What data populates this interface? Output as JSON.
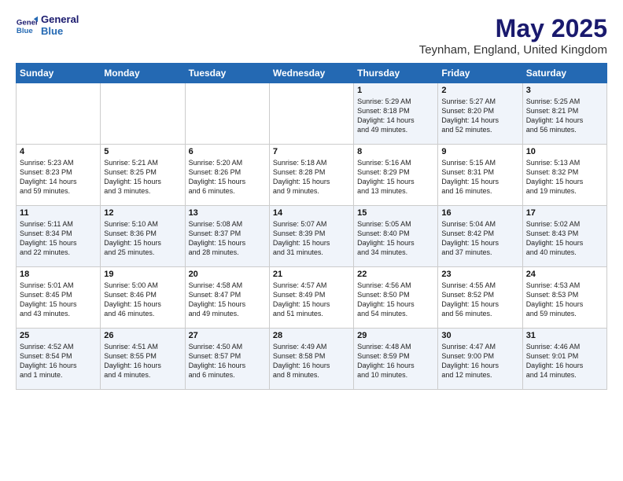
{
  "logo": {
    "line1": "General",
    "line2": "Blue"
  },
  "title": "May 2025",
  "subtitle": "Teynham, England, United Kingdom",
  "days_header": [
    "Sunday",
    "Monday",
    "Tuesday",
    "Wednesday",
    "Thursday",
    "Friday",
    "Saturday"
  ],
  "weeks": [
    [
      {
        "day": "",
        "info": ""
      },
      {
        "day": "",
        "info": ""
      },
      {
        "day": "",
        "info": ""
      },
      {
        "day": "",
        "info": ""
      },
      {
        "day": "1",
        "info": "Sunrise: 5:29 AM\nSunset: 8:18 PM\nDaylight: 14 hours\nand 49 minutes."
      },
      {
        "day": "2",
        "info": "Sunrise: 5:27 AM\nSunset: 8:20 PM\nDaylight: 14 hours\nand 52 minutes."
      },
      {
        "day": "3",
        "info": "Sunrise: 5:25 AM\nSunset: 8:21 PM\nDaylight: 14 hours\nand 56 minutes."
      }
    ],
    [
      {
        "day": "4",
        "info": "Sunrise: 5:23 AM\nSunset: 8:23 PM\nDaylight: 14 hours\nand 59 minutes."
      },
      {
        "day": "5",
        "info": "Sunrise: 5:21 AM\nSunset: 8:25 PM\nDaylight: 15 hours\nand 3 minutes."
      },
      {
        "day": "6",
        "info": "Sunrise: 5:20 AM\nSunset: 8:26 PM\nDaylight: 15 hours\nand 6 minutes."
      },
      {
        "day": "7",
        "info": "Sunrise: 5:18 AM\nSunset: 8:28 PM\nDaylight: 15 hours\nand 9 minutes."
      },
      {
        "day": "8",
        "info": "Sunrise: 5:16 AM\nSunset: 8:29 PM\nDaylight: 15 hours\nand 13 minutes."
      },
      {
        "day": "9",
        "info": "Sunrise: 5:15 AM\nSunset: 8:31 PM\nDaylight: 15 hours\nand 16 minutes."
      },
      {
        "day": "10",
        "info": "Sunrise: 5:13 AM\nSunset: 8:32 PM\nDaylight: 15 hours\nand 19 minutes."
      }
    ],
    [
      {
        "day": "11",
        "info": "Sunrise: 5:11 AM\nSunset: 8:34 PM\nDaylight: 15 hours\nand 22 minutes."
      },
      {
        "day": "12",
        "info": "Sunrise: 5:10 AM\nSunset: 8:36 PM\nDaylight: 15 hours\nand 25 minutes."
      },
      {
        "day": "13",
        "info": "Sunrise: 5:08 AM\nSunset: 8:37 PM\nDaylight: 15 hours\nand 28 minutes."
      },
      {
        "day": "14",
        "info": "Sunrise: 5:07 AM\nSunset: 8:39 PM\nDaylight: 15 hours\nand 31 minutes."
      },
      {
        "day": "15",
        "info": "Sunrise: 5:05 AM\nSunset: 8:40 PM\nDaylight: 15 hours\nand 34 minutes."
      },
      {
        "day": "16",
        "info": "Sunrise: 5:04 AM\nSunset: 8:42 PM\nDaylight: 15 hours\nand 37 minutes."
      },
      {
        "day": "17",
        "info": "Sunrise: 5:02 AM\nSunset: 8:43 PM\nDaylight: 15 hours\nand 40 minutes."
      }
    ],
    [
      {
        "day": "18",
        "info": "Sunrise: 5:01 AM\nSunset: 8:45 PM\nDaylight: 15 hours\nand 43 minutes."
      },
      {
        "day": "19",
        "info": "Sunrise: 5:00 AM\nSunset: 8:46 PM\nDaylight: 15 hours\nand 46 minutes."
      },
      {
        "day": "20",
        "info": "Sunrise: 4:58 AM\nSunset: 8:47 PM\nDaylight: 15 hours\nand 49 minutes."
      },
      {
        "day": "21",
        "info": "Sunrise: 4:57 AM\nSunset: 8:49 PM\nDaylight: 15 hours\nand 51 minutes."
      },
      {
        "day": "22",
        "info": "Sunrise: 4:56 AM\nSunset: 8:50 PM\nDaylight: 15 hours\nand 54 minutes."
      },
      {
        "day": "23",
        "info": "Sunrise: 4:55 AM\nSunset: 8:52 PM\nDaylight: 15 hours\nand 56 minutes."
      },
      {
        "day": "24",
        "info": "Sunrise: 4:53 AM\nSunset: 8:53 PM\nDaylight: 15 hours\nand 59 minutes."
      }
    ],
    [
      {
        "day": "25",
        "info": "Sunrise: 4:52 AM\nSunset: 8:54 PM\nDaylight: 16 hours\nand 1 minute."
      },
      {
        "day": "26",
        "info": "Sunrise: 4:51 AM\nSunset: 8:55 PM\nDaylight: 16 hours\nand 4 minutes."
      },
      {
        "day": "27",
        "info": "Sunrise: 4:50 AM\nSunset: 8:57 PM\nDaylight: 16 hours\nand 6 minutes."
      },
      {
        "day": "28",
        "info": "Sunrise: 4:49 AM\nSunset: 8:58 PM\nDaylight: 16 hours\nand 8 minutes."
      },
      {
        "day": "29",
        "info": "Sunrise: 4:48 AM\nSunset: 8:59 PM\nDaylight: 16 hours\nand 10 minutes."
      },
      {
        "day": "30",
        "info": "Sunrise: 4:47 AM\nSunset: 9:00 PM\nDaylight: 16 hours\nand 12 minutes."
      },
      {
        "day": "31",
        "info": "Sunrise: 4:46 AM\nSunset: 9:01 PM\nDaylight: 16 hours\nand 14 minutes."
      }
    ]
  ]
}
